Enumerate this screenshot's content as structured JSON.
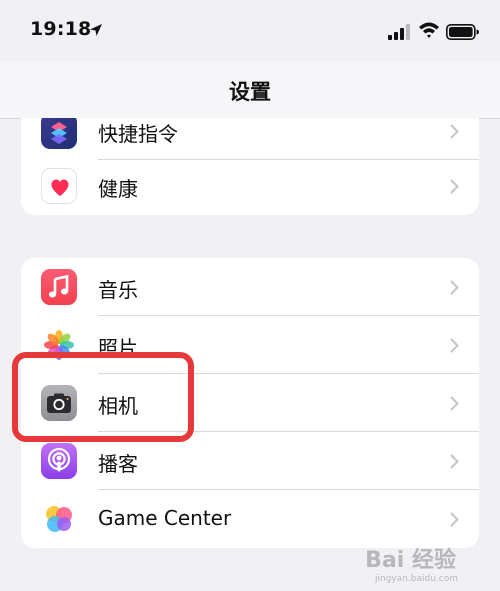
{
  "status_bar": {
    "time": "19:18"
  },
  "nav": {
    "title": "设置"
  },
  "groups": [
    {
      "items": [
        {
          "label": "快捷指令",
          "icon": "shortcuts-icon"
        },
        {
          "label": "健康",
          "icon": "health-heart-icon"
        }
      ]
    },
    {
      "items": [
        {
          "label": "音乐",
          "icon": "music-icon"
        },
        {
          "label": "照片",
          "icon": "photos-icon"
        },
        {
          "label": "相机",
          "icon": "camera-icon",
          "highlighted": true
        },
        {
          "label": "播客",
          "icon": "podcasts-icon"
        },
        {
          "label": "Game Center",
          "icon": "game-center-icon"
        }
      ]
    }
  ],
  "colors": {
    "background": "#f0f0f5",
    "highlight_border": "#e63a3a",
    "music": "#f2414f",
    "podcasts": "#9b4cf0",
    "camera": "#8e8e93"
  },
  "watermark": {
    "text": "Bai 经验",
    "subtext": "jingyan.baidu.com"
  }
}
